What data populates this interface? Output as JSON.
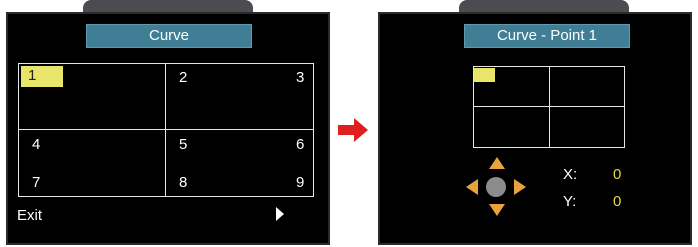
{
  "left_screen": {
    "title": "Curve",
    "cells": [
      "1",
      "2",
      "3",
      "4",
      "5",
      "6",
      "7",
      "8",
      "9"
    ],
    "selected_cell": "1",
    "exit_label": "Exit"
  },
  "right_screen": {
    "title": "Curve - Point 1",
    "x_label": "X:",
    "x_value": "0",
    "y_label": "Y:",
    "y_value": "0"
  },
  "colors": {
    "highlight": "#e8e56a",
    "title_bar": "#3f7e95",
    "dpad": "#e8a33a",
    "transition_arrow": "#e02020",
    "value": "#e8d84a"
  },
  "icons": {
    "transition": "arrow-right-icon",
    "exit": "triangle-right-icon",
    "dpad": "dpad-icon"
  }
}
